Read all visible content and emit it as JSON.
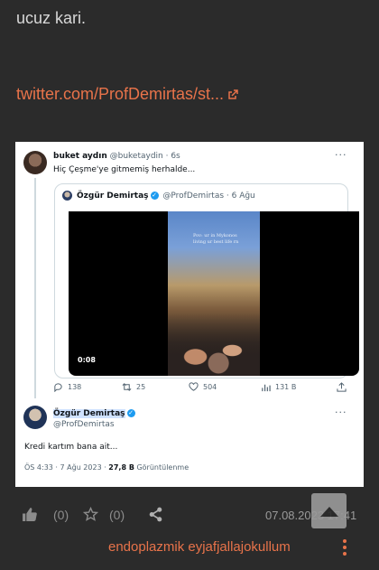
{
  "entry": {
    "text": "ucuz kari.",
    "link": "twitter.com/ProfDemirtas/st..."
  },
  "tweet_image": {
    "reply": {
      "name": "buket aydın",
      "handle": "@buketaydin · 6s",
      "text": "Hiç Çeşme'ye gitmemiş herhalde..."
    },
    "quoted": {
      "name": "Özgür Demirtaş",
      "handle": "@ProfDemirtas · 6 Ağu",
      "video_duration": "0:08",
      "video_overlay": [
        "Pov: ur in Mykonos",
        "living ur best life rn"
      ]
    },
    "actions": {
      "replies": "138",
      "retweets": "25",
      "likes": "504",
      "views": "131 B"
    },
    "main": {
      "name": "Özgür Demirtaş",
      "handle": "@ProfDemirtas",
      "text": "Kredi kartım bana ait...",
      "meta_time": "ÖS 4:33 · 7 Ağu 2023 · ",
      "meta_views": "27,8 B",
      "meta_views_label": " Görüntülenme"
    }
  },
  "bottom": {
    "upvotes": "(0)",
    "favorites": "(0)",
    "date": "07.08.2023 17:41",
    "author": "endoplazmik eyjafjallajokullum"
  },
  "colors": {
    "background": "#2b2b2b",
    "accent": "#e8734a",
    "twitter_blue": "#1d9bf0"
  },
  "icons": [
    "thumbs-up-icon",
    "star-icon",
    "share-icon",
    "external-link-icon",
    "scroll-top-icon",
    "kebab-icon",
    "reply-icon",
    "retweet-icon",
    "like-icon",
    "views-icon",
    "tweet-share-icon",
    "verified-icon"
  ]
}
